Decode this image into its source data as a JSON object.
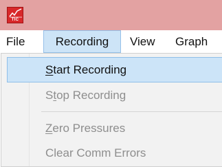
{
  "app": {
    "icon_name": "chart-icon",
    "icon_text": "TIC"
  },
  "menubar": {
    "items": [
      {
        "label": "File"
      },
      {
        "label": "Recording",
        "active": true
      },
      {
        "label": "View"
      },
      {
        "label": "Graph"
      }
    ]
  },
  "recording_menu": {
    "items": [
      {
        "label": "Start Recording",
        "mnemonic": "S",
        "rest": "tart Recording",
        "enabled": true,
        "highlighted": true
      },
      {
        "label": "Stop Recording",
        "mnemonic": "t",
        "prefix": "S",
        "rest": "op Recording",
        "enabled": false
      },
      {
        "label": "Zero Pressures",
        "mnemonic": "Z",
        "rest": "ero Pressures",
        "enabled": false
      },
      {
        "label": "Clear Comm Errors",
        "enabled": false
      }
    ]
  },
  "colors": {
    "titlebar": "#e3a2a2",
    "menu_highlight": "#cde4f7",
    "menu_highlight_border": "#94c0e8",
    "disabled_text": "#8e8e8e"
  }
}
